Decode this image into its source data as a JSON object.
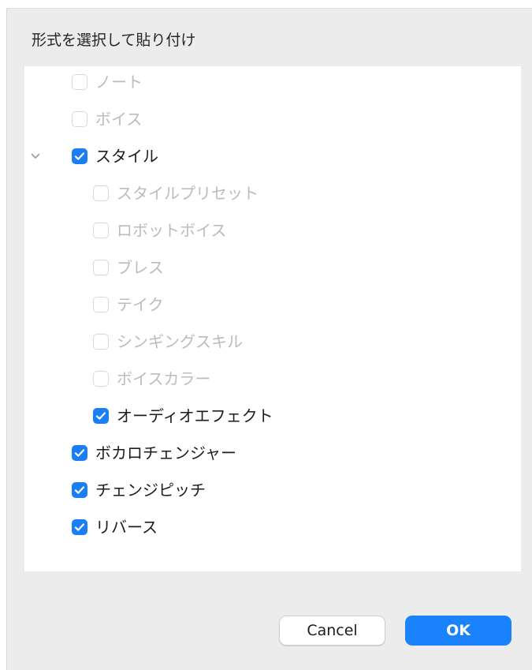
{
  "dialog": {
    "title": "形式を選択して貼り付け"
  },
  "options": [
    {
      "label": "ノート",
      "checked": false,
      "enabled": false,
      "level": 1
    },
    {
      "label": "ボイス",
      "checked": false,
      "enabled": false,
      "level": 1
    },
    {
      "label": "スタイル",
      "checked": true,
      "enabled": true,
      "level": 1,
      "expanded": true
    },
    {
      "label": "スタイルプリセット",
      "checked": false,
      "enabled": false,
      "level": 2
    },
    {
      "label": "ロボットボイス",
      "checked": false,
      "enabled": false,
      "level": 2
    },
    {
      "label": "ブレス",
      "checked": false,
      "enabled": false,
      "level": 2
    },
    {
      "label": "テイク",
      "checked": false,
      "enabled": false,
      "level": 2
    },
    {
      "label": "シンギングスキル",
      "checked": false,
      "enabled": false,
      "level": 2
    },
    {
      "label": "ボイスカラー",
      "checked": false,
      "enabled": false,
      "level": 2
    },
    {
      "label": "オーディオエフェクト",
      "checked": true,
      "enabled": true,
      "level": 2
    },
    {
      "label": "ボカロチェンジャー",
      "checked": true,
      "enabled": true,
      "level": 1
    },
    {
      "label": "チェンジピッチ",
      "checked": true,
      "enabled": true,
      "level": 1
    },
    {
      "label": "リバース",
      "checked": true,
      "enabled": true,
      "level": 1
    }
  ],
  "buttons": {
    "cancel_label": "Cancel",
    "ok_label": "OK"
  },
  "colors": {
    "accent": "#1a7ef5",
    "dialog_background": "#ececec",
    "disabled_text": "#bcbcbc"
  },
  "icons": {
    "disclosure": "chevron-down-icon",
    "checkmark": "checkmark-icon"
  }
}
